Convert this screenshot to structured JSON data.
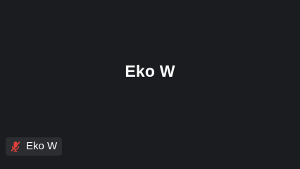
{
  "participant": {
    "display_name": "Eko W",
    "tag_name": "Eko W",
    "mic_state_icon": "mic-muted-icon",
    "mic_muted": true
  },
  "colors": {
    "background": "#1a1c1f",
    "tag_background": "#2b2d31",
    "muted_icon": "#e0413a",
    "text": "#ffffff"
  }
}
